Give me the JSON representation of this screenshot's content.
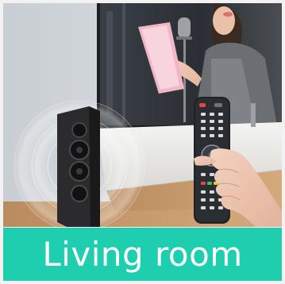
{
  "caption": {
    "text": "Living room",
    "background": "#1dcfae",
    "color": "#ffffff"
  },
  "scene": {
    "objects": [
      "living-room-photo",
      "wall-tv-screen",
      "singer-with-microphone",
      "floor-speaker-tower",
      "sound-wave-rings",
      "tv-stand-cabinet",
      "hand-holding-remote",
      "remote-control"
    ]
  }
}
